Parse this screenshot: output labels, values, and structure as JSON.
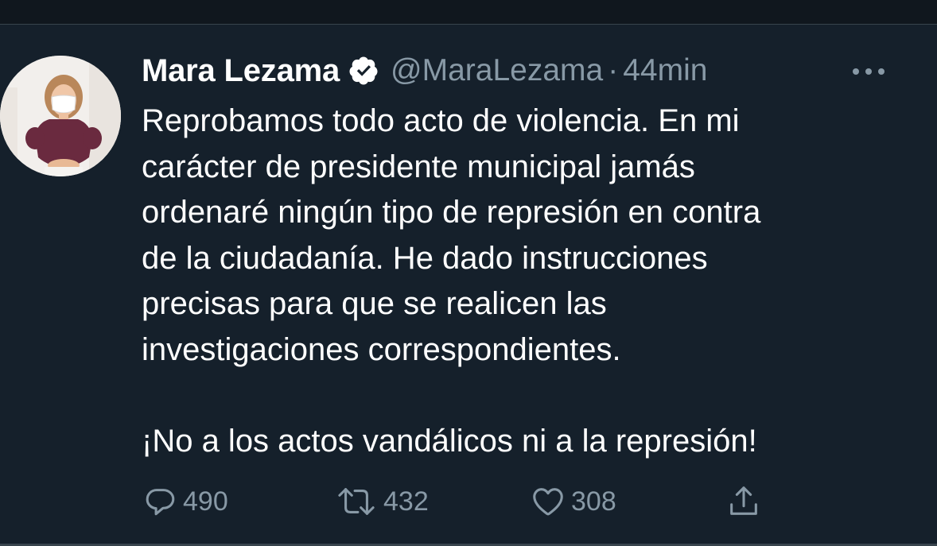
{
  "tweet": {
    "author_name": "Mara Lezama",
    "handle": "@MaraLezama",
    "separator": "·",
    "time": "44min",
    "lines": [
      "Reprobamos todo acto de violencia. En mi",
      "carácter de presidente municipal jamás",
      "ordenaré ningún tipo de represión en contra",
      "de la ciudadanía. He dado instrucciones",
      "precisas para que se realicen las",
      "investigaciones correspondientes."
    ],
    "closing_line": "¡No a los actos vandálicos ni a la represión!"
  },
  "actions": {
    "replies": "490",
    "retweets": "432",
    "likes": "308"
  },
  "icons": {
    "verified": "verified-badge-icon",
    "more": "more-options-icon",
    "reply": "reply-icon",
    "retweet": "retweet-icon",
    "like": "heart-icon",
    "share": "share-icon"
  },
  "colors": {
    "background": "#15202b",
    "text": "#ffffff",
    "secondary_text": "#8899a6",
    "divider": "#38444d"
  }
}
